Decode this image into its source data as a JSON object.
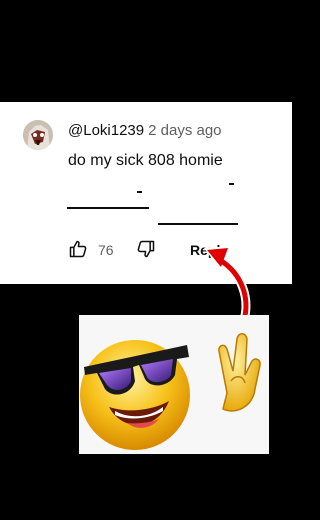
{
  "comment": {
    "username": "@Loki1239",
    "timestamp": "2 days ago",
    "text": "do my sick 808 homie",
    "like_count": "76",
    "reply_label": "Reply"
  },
  "icons": {
    "avatar": "avatar",
    "like": "thumbs-up-icon",
    "dislike": "thumbs-down-icon",
    "arrow": "red-arrow-icon",
    "emoji": "sunglasses-rock-emoji"
  },
  "colors": {
    "text_primary": "#0f0f0f",
    "text_secondary": "#606060",
    "arrow_red": "#e00000",
    "emoji_yellow": "#f7c21a"
  }
}
